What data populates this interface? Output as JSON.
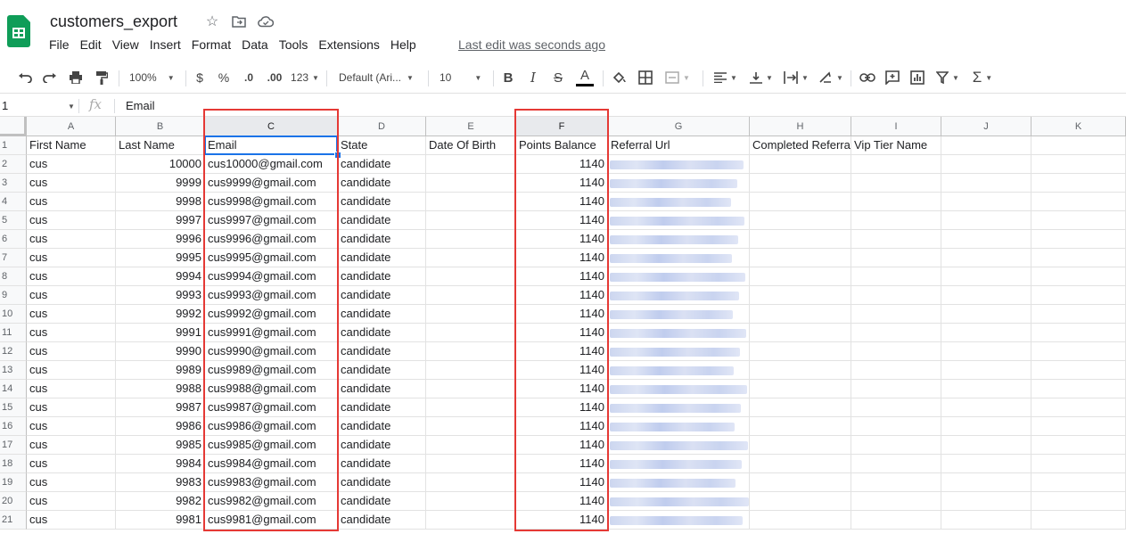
{
  "app": {
    "doc_title": "customers_export",
    "menu": [
      "File",
      "Edit",
      "View",
      "Insert",
      "Format",
      "Data",
      "Tools",
      "Extensions",
      "Help"
    ],
    "last_edit": "Last edit was seconds ago"
  },
  "toolbar": {
    "zoom": "100%",
    "currency": "$",
    "percent": "%",
    "dec_decrease": ".0",
    "dec_increase": ".00",
    "more_formats": "123",
    "font": "Default (Ari...",
    "font_size": "10",
    "bold": "B",
    "italic": "I",
    "strike": "S",
    "text_color": "A"
  },
  "formula_bar": {
    "name_box": "1",
    "fx": "fx",
    "value": "Email"
  },
  "columns": [
    "A",
    "B",
    "C",
    "D",
    "E",
    "F",
    "G",
    "H",
    "I",
    "J",
    "K"
  ],
  "headers": [
    "First Name",
    "Last Name",
    "Email",
    "State",
    "Date Of Birth",
    "Points Balance",
    "Referral Url",
    "Completed Referra",
    "Vip Tier Name",
    "",
    ""
  ],
  "rows": [
    {
      "n": "2",
      "first": "cus",
      "last": "10000",
      "email": "cus10000@gmail.com",
      "state": "candidate",
      "points": "1140"
    },
    {
      "n": "3",
      "first": "cus",
      "last": "9999",
      "email": "cus9999@gmail.com",
      "state": "candidate",
      "points": "1140"
    },
    {
      "n": "4",
      "first": "cus",
      "last": "9998",
      "email": "cus9998@gmail.com",
      "state": "candidate",
      "points": "1140"
    },
    {
      "n": "5",
      "first": "cus",
      "last": "9997",
      "email": "cus9997@gmail.com",
      "state": "candidate",
      "points": "1140"
    },
    {
      "n": "6",
      "first": "cus",
      "last": "9996",
      "email": "cus9996@gmail.com",
      "state": "candidate",
      "points": "1140"
    },
    {
      "n": "7",
      "first": "cus",
      "last": "9995",
      "email": "cus9995@gmail.com",
      "state": "candidate",
      "points": "1140"
    },
    {
      "n": "8",
      "first": "cus",
      "last": "9994",
      "email": "cus9994@gmail.com",
      "state": "candidate",
      "points": "1140"
    },
    {
      "n": "9",
      "first": "cus",
      "last": "9993",
      "email": "cus9993@gmail.com",
      "state": "candidate",
      "points": "1140"
    },
    {
      "n": "10",
      "first": "cus",
      "last": "9992",
      "email": "cus9992@gmail.com",
      "state": "candidate",
      "points": "1140"
    },
    {
      "n": "11",
      "first": "cus",
      "last": "9991",
      "email": "cus9991@gmail.com",
      "state": "candidate",
      "points": "1140"
    },
    {
      "n": "12",
      "first": "cus",
      "last": "9990",
      "email": "cus9990@gmail.com",
      "state": "candidate",
      "points": "1140"
    },
    {
      "n": "13",
      "first": "cus",
      "last": "9989",
      "email": "cus9989@gmail.com",
      "state": "candidate",
      "points": "1140"
    },
    {
      "n": "14",
      "first": "cus",
      "last": "9988",
      "email": "cus9988@gmail.com",
      "state": "candidate",
      "points": "1140"
    },
    {
      "n": "15",
      "first": "cus",
      "last": "9987",
      "email": "cus9987@gmail.com",
      "state": "candidate",
      "points": "1140"
    },
    {
      "n": "16",
      "first": "cus",
      "last": "9986",
      "email": "cus9986@gmail.com",
      "state": "candidate",
      "points": "1140"
    },
    {
      "n": "17",
      "first": "cus",
      "last": "9985",
      "email": "cus9985@gmail.com",
      "state": "candidate",
      "points": "1140"
    },
    {
      "n": "18",
      "first": "cus",
      "last": "9984",
      "email": "cus9984@gmail.com",
      "state": "candidate",
      "points": "1140"
    },
    {
      "n": "19",
      "first": "cus",
      "last": "9983",
      "email": "cus9983@gmail.com",
      "state": "candidate",
      "points": "1140"
    },
    {
      "n": "20",
      "first": "cus",
      "last": "9982",
      "email": "cus9982@gmail.com",
      "state": "candidate",
      "points": "1140"
    },
    {
      "n": "21",
      "first": "cus",
      "last": "9981",
      "email": "cus9981@gmail.com",
      "state": "candidate",
      "points": "1140"
    }
  ],
  "colors": {
    "brand": "#0f9d58",
    "selection": "#1a73e8",
    "highlight_box": "#e53935"
  }
}
